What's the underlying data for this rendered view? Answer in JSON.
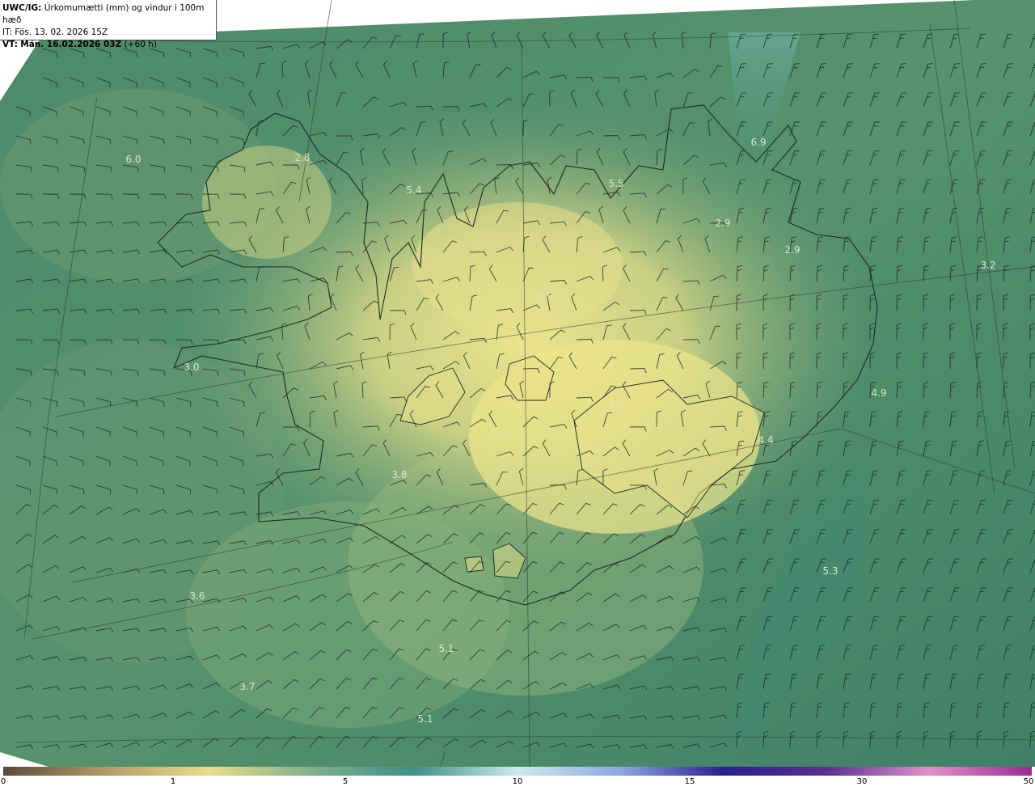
{
  "header": {
    "model": "UWC/IG:",
    "description": "Úrkomumætti (mm) og vindur i 100m hæð",
    "init_time": "IT: Fös. 13. 02. 2026 15Z",
    "valid_label": "VT:",
    "valid_time": "Mán. 16.02.2026 03Z",
    "lead": "(+60 h)"
  },
  "map_values": [
    {
      "text": "6.0"
    },
    {
      "text": "2.8"
    },
    {
      "text": "5.4"
    },
    {
      "text": "5.5"
    },
    {
      "text": "6.9"
    },
    {
      "text": "2.9"
    },
    {
      "text": "2.9"
    },
    {
      "text": "3.2"
    },
    {
      "text": "2.0"
    },
    {
      "text": "3.0"
    },
    {
      "text": "1.0"
    },
    {
      "text": "4.4"
    },
    {
      "text": "4.9"
    },
    {
      "text": "3.8"
    },
    {
      "text": "5.3"
    },
    {
      "text": "3.6"
    },
    {
      "text": "5.1"
    },
    {
      "text": "3.7"
    },
    {
      "text": "5.1"
    }
  ],
  "colorbar": {
    "ticks": [
      "0",
      "1",
      "5",
      "10",
      "15",
      "30",
      "50"
    ],
    "colors": [
      "#5a4a3a",
      "#b59a6a",
      "#e8dc8a",
      "#7fb08a",
      "#3f8f88",
      "#cde9ee",
      "#8fa6df",
      "#2a1f8f",
      "#5b2f8f",
      "#e090cc",
      "#9b2a8f"
    ]
  },
  "colors": {
    "land_light": "#e4e08a",
    "land_mid": "#a9c17c",
    "sea_mid": "#4f8d6e",
    "sea_dark": "#3b7a66",
    "coast": "#1c2a20"
  }
}
